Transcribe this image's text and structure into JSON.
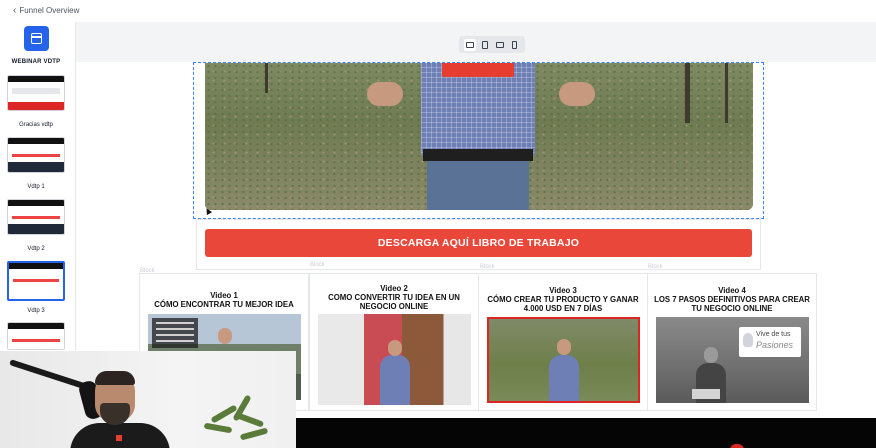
{
  "topbar": {
    "back_label": "Funnel Overview"
  },
  "sidebar": {
    "funnel_name": "WEBINAR VDTP",
    "steps": [
      {
        "label": "Gracias vdtp"
      },
      {
        "label": "Vdtp 1"
      },
      {
        "label": "Vdtp 2"
      },
      {
        "label": "Vdtp 3"
      }
    ]
  },
  "device_switcher": [
    "desktop-icon",
    "tablet-icon",
    "tablet-landscape-icon",
    "mobile-icon"
  ],
  "canvas": {
    "cta_label": "DESCARGA AQUÍ LIBRO DE TRABAJO",
    "column_tag": "Block",
    "videos": [
      {
        "number": "Video 1",
        "title": "CÓMO ENCONTRAR TU MEJOR IDEA"
      },
      {
        "number": "Video 2",
        "title": "COMO CONVERTIR TU IDEA EN UN NEGOCIO ONLINE"
      },
      {
        "number": "Video 3",
        "title": "CÓMO CREAR TU PRODUCTO Y GANAR 4.000 USD EN 7 DÍAS"
      },
      {
        "number": "Video 4",
        "title": "LOS 7 PASOS DEFINITIVOS PARA CREAR TU NEGOCIO ONLINE"
      }
    ],
    "video4_brand_line1": "Vive de tus",
    "video4_brand_line2": "Pasiones"
  },
  "colors": {
    "accent": "#2563eb",
    "cta": "#e8473a",
    "selection": "#3b82f6"
  }
}
